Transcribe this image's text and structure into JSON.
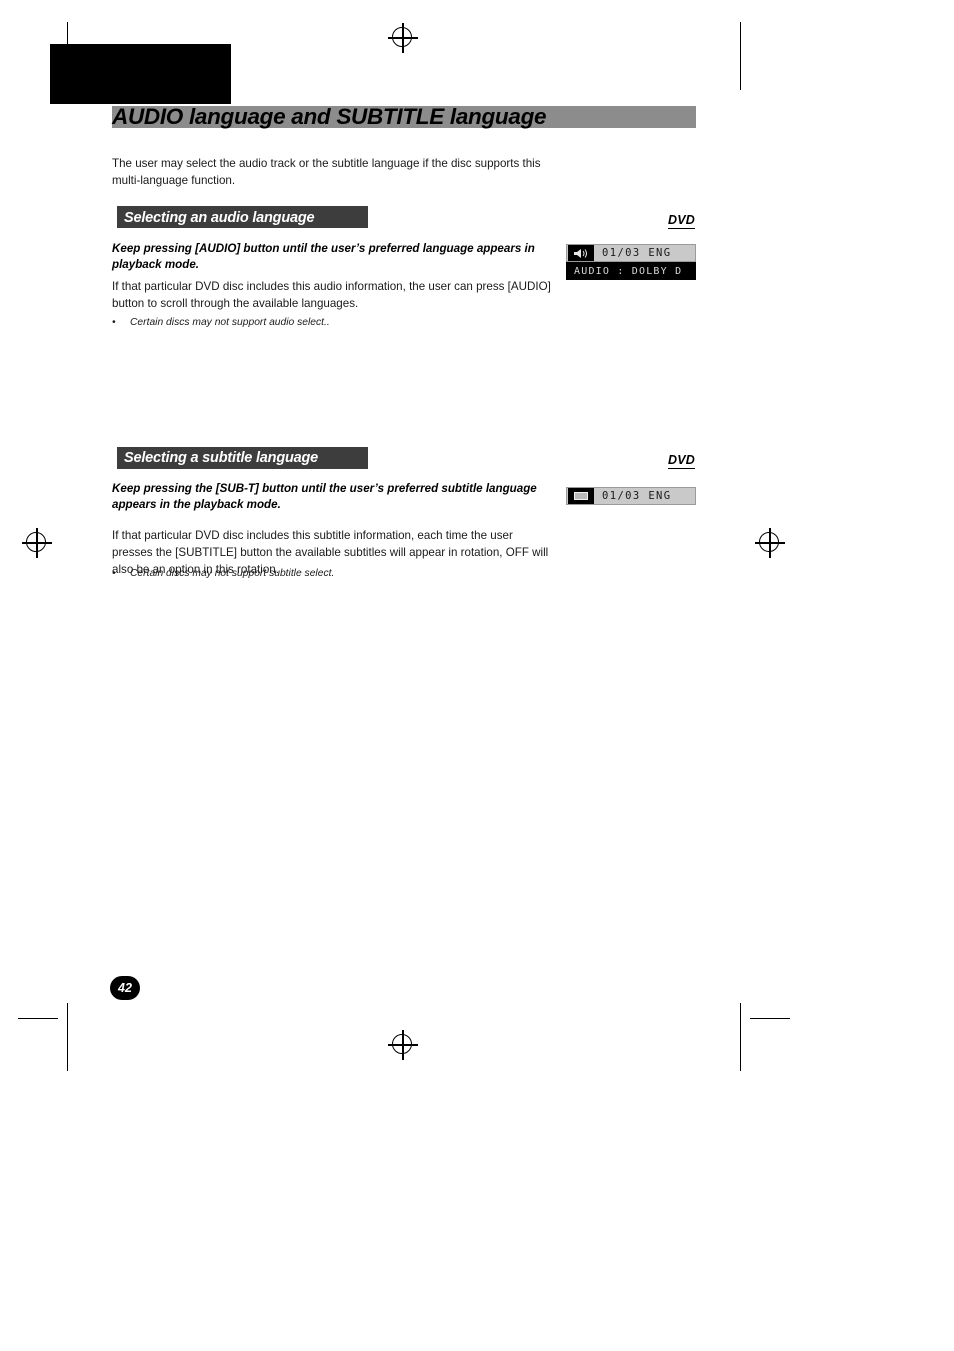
{
  "document": {
    "title": "AUDIO language and SUBTITLE language",
    "intro": "The user may select the audio track or the subtitle language if the disc supports this multi-language function.",
    "page_number": "42"
  },
  "sections": [
    {
      "heading": "Selecting an audio language",
      "badge": "DVD",
      "lead": "Keep pressing [AUDIO] button until the user’s preferred language appears in playback mode.",
      "body": "If that particular DVD disc includes this audio information, the user can press [AUDIO] button to scroll through the available languages.",
      "bullet": "Certain discs may not support audio select..",
      "bullet_marker": "•",
      "osd": {
        "icon": "speaker-icon",
        "line1": "01/03 ENG",
        "line2": "AUDIO  :  DOLBY  D"
      }
    },
    {
      "heading": "Selecting a subtitle language",
      "badge": "DVD",
      "lead": "Keep pressing the [SUB-T] button until the user’s preferred subtitle language appears in the playback mode.",
      "body": "If that particular DVD disc includes this subtitle information, each time the user presses the [SUBTITLE] button the available subtitles will appear in rotation, OFF will also be an option in this rotation.",
      "bullet": "Certain discs may not support subtitle select.",
      "bullet_marker": "•",
      "osd": {
        "icon": "subtitle-icon",
        "line1": "01/03 ENG"
      }
    }
  ],
  "colors": {
    "title_bar": "#8c8c8c",
    "section_bar": "#3d3d3d",
    "osd_bg": "#c9c9c9",
    "osd_dark": "#000000"
  }
}
